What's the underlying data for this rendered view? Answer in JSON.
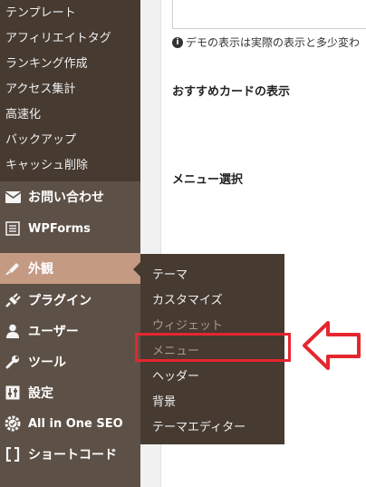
{
  "sidebar": {
    "submenu_items": [
      "テンプレート",
      "アフィリエイトタグ",
      "ランキング作成",
      "アクセス集計",
      "高速化",
      "バックアップ",
      "キャッシュ削除"
    ],
    "menu": {
      "contact": "お問い合わせ",
      "wpforms": "WPForms",
      "appearance": "外観",
      "plugins": "プラグイン",
      "users": "ユーザー",
      "tools": "ツール",
      "settings": "設定",
      "aioseo": "All in One SEO",
      "shortcode": "ショートコード"
    }
  },
  "flyout": {
    "items": [
      "テーマ",
      "カスタマイズ",
      "ウィジェット",
      "メニュー",
      "ヘッダー",
      "背景",
      "テーマエディター"
    ]
  },
  "main": {
    "notice": "デモの表示は実際の表示と多少変わ",
    "heading1": "おすすめカードの表示",
    "heading2": "メニュー選択"
  },
  "colors": {
    "sidebar": "#5d5046",
    "submenu": "#463a31",
    "active": "#c49a83",
    "highlight": "#e5262f"
  }
}
